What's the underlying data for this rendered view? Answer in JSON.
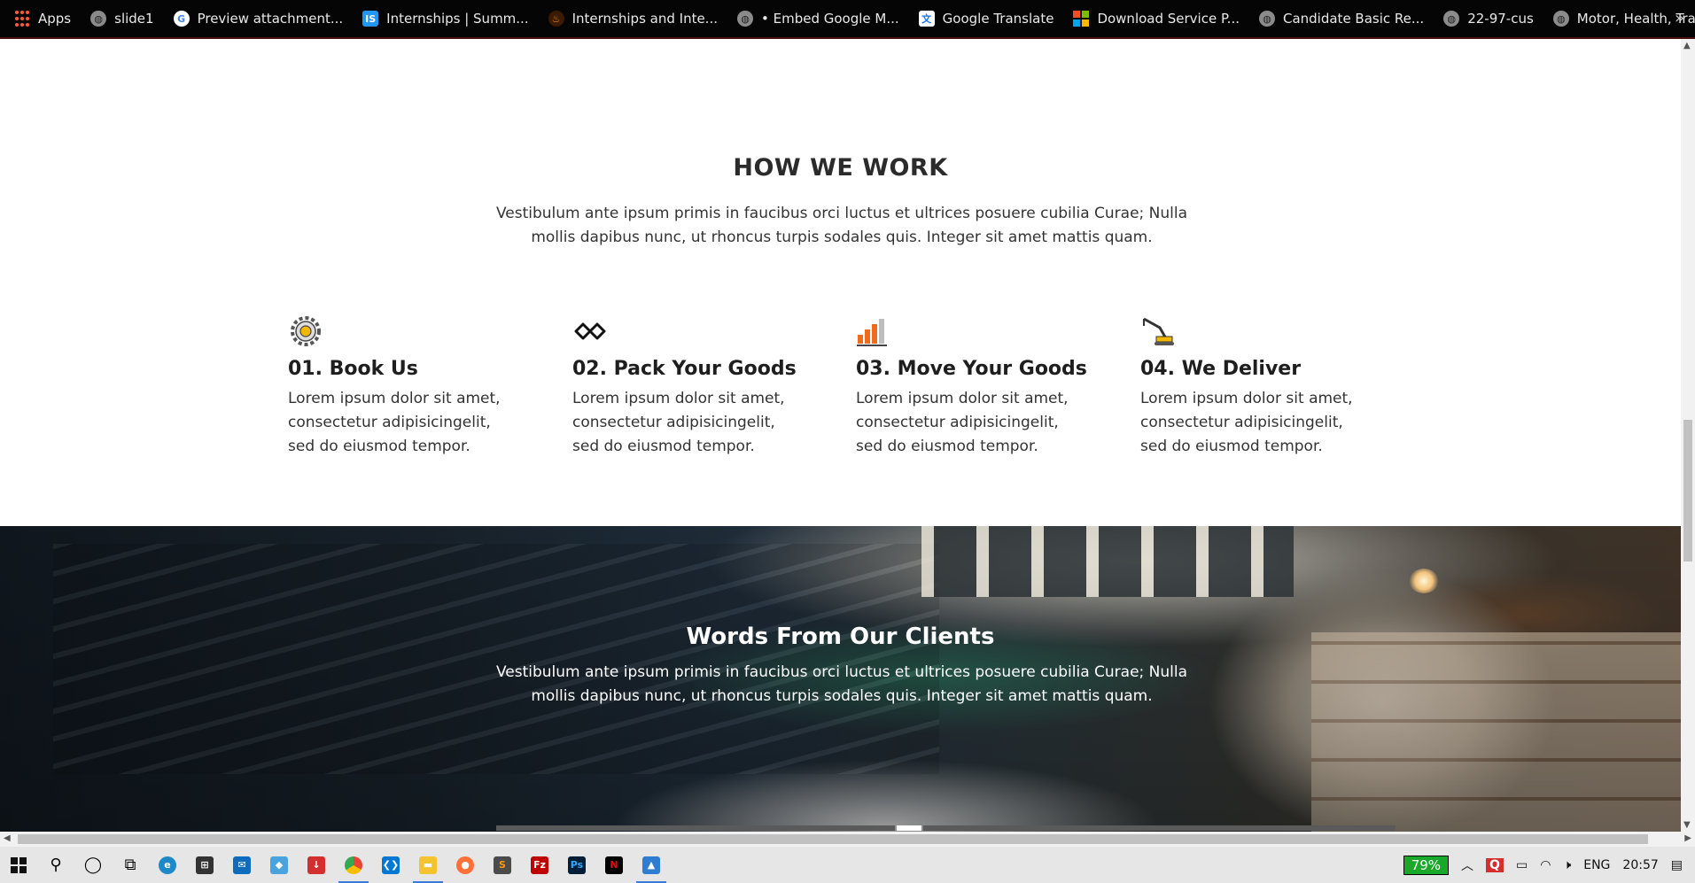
{
  "bookmarks": [
    {
      "label": "Apps",
      "icon": "apps-grid-icon"
    },
    {
      "label": "slide1",
      "icon": "globe-icon"
    },
    {
      "label": "Preview attachment...",
      "icon": "google-icon"
    },
    {
      "label": "Internships | Summ...",
      "icon": "internshala-icon"
    },
    {
      "label": "Internships and Inte...",
      "icon": "flame-icon"
    },
    {
      "label": "• Embed Google M...",
      "icon": "globe-icon"
    },
    {
      "label": "Google Translate",
      "icon": "google-translate-icon"
    },
    {
      "label": "Download Service P...",
      "icon": "microsoft-icon"
    },
    {
      "label": "Candidate Basic Re...",
      "icon": "globe-icon"
    },
    {
      "label": "22-97-cus",
      "icon": "globe-icon"
    },
    {
      "label": "Motor, Health, Trav...",
      "icon": "globe-icon"
    }
  ],
  "bookmarks_more": "»",
  "how": {
    "title": "HOW WE WORK",
    "description": "Vestibulum ante ipsum primis in faucibus orci luctus et ultrices posuere cubilia Curae; Nulla mollis dapibus nunc, ut rhoncus turpis sodales quis. Integer sit amet mattis quam.",
    "steps": [
      {
        "title": "01. Book Us",
        "text": "Lorem ipsum dolor sit amet, consectetur adipisicingelit, sed do eiusmod tempor.",
        "icon": "gear-icon"
      },
      {
        "title": "02. Pack Your Goods",
        "text": "Lorem ipsum dolor sit amet, consectetur adipisicingelit, sed do eiusmod tempor.",
        "icon": "handshake-icon"
      },
      {
        "title": "03. Move Your Goods",
        "text": "Lorem ipsum dolor sit amet, consectetur adipisicingelit, sed do eiusmod tempor.",
        "icon": "bar-chart-icon"
      },
      {
        "title": "04. We Deliver",
        "text": "Lorem ipsum dolor sit amet, consectetur adipisicingelit, sed do eiusmod tempor.",
        "icon": "crane-icon"
      }
    ]
  },
  "clients": {
    "title": "Words From Our Clients",
    "description": "Vestibulum ante ipsum primis in faucibus orci luctus et ultrices posuere cubilia Curae; Nulla mollis dapibus nunc, ut rhoncus turpis sodales quis. Integer sit amet mattis quam."
  },
  "taskbar": {
    "apps": [
      "start-icon",
      "search-icon",
      "cortana-icon",
      "task-view-icon",
      "edge-icon",
      "store-icon",
      "mail-icon",
      "app-icon",
      "download-icon",
      "chrome-icon",
      "vscode-icon",
      "file-explorer-icon",
      "firefox-icon",
      "sublime-icon",
      "filezilla-icon",
      "photoshop-icon",
      "netflix-icon",
      "photos-icon"
    ],
    "battery_percent": "79%",
    "language": "ENG",
    "time": "20:57"
  },
  "colors": {
    "accent_orange": "#f26b1d",
    "bookmarks_bg": "#050505",
    "battery_green": "#1aa82a"
  }
}
